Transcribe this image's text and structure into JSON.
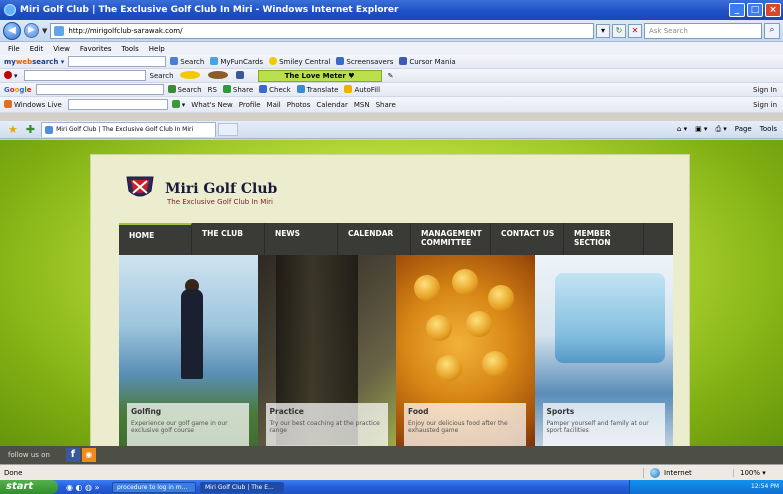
{
  "window": {
    "title": "Miri Golf Club | The Exclusive Golf Club In Miri - Windows Internet Explorer"
  },
  "address": {
    "url": "http://mirigolfclub-sarawak.com/",
    "search_placeholder": "Ask Search"
  },
  "menu": [
    "File",
    "Edit",
    "View",
    "Favorites",
    "Tools",
    "Help"
  ],
  "toolbar1": {
    "brand_my": "my",
    "brand_web": "web",
    "brand_search": "search",
    "items": [
      "Search",
      "MyFunCards",
      "Smiley Central",
      "Screensavers",
      "Cursor Mania"
    ]
  },
  "toolbar2": {
    "search": "Search",
    "love_meter": "The Love Meter ♥"
  },
  "toolbar3": {
    "items": [
      "Search",
      "RS",
      "Share",
      "Check",
      "Translate",
      "AutoFill"
    ],
    "signin": "Sign In"
  },
  "toolbar4": {
    "brand": "Windows Live",
    "items": [
      "What's New",
      "Profile",
      "Mail",
      "Photos",
      "Calendar",
      "MSN",
      "Share"
    ],
    "signin": "Sign in"
  },
  "tab": {
    "label": "Miri Golf Club | The Exclusive Golf Club In Miri"
  },
  "tab_tools": [
    "Page",
    "Tools"
  ],
  "site": {
    "title": "Miri Golf Club",
    "tagline": "The Exclusive Golf Club In Miri",
    "nav": [
      "HOME",
      "THE CLUB",
      "NEWS",
      "CALENDAR",
      "MANAGEMENT COMMITTEE",
      "CONTACT US",
      "MEMBER SECTION"
    ],
    "panels": [
      {
        "title": "Golfing",
        "desc": "Experience our golf game in our exclusive golf course"
      },
      {
        "title": "Practice",
        "desc": "Try our best coaching at the practice range"
      },
      {
        "title": "Food",
        "desc": "Enjoy our delicious food after the exhausted game"
      },
      {
        "title": "Sports",
        "desc": "Pamper yourself and family at our sport facilities"
      }
    ],
    "follow": "follow us on"
  },
  "status": {
    "text": "Done",
    "zone": "Internet",
    "zoom": "100%"
  },
  "taskbar": {
    "start": "start",
    "tasks": [
      "procedure to log in m...",
      "Miri Golf Club | The E..."
    ],
    "clock": "12:54 PM"
  }
}
